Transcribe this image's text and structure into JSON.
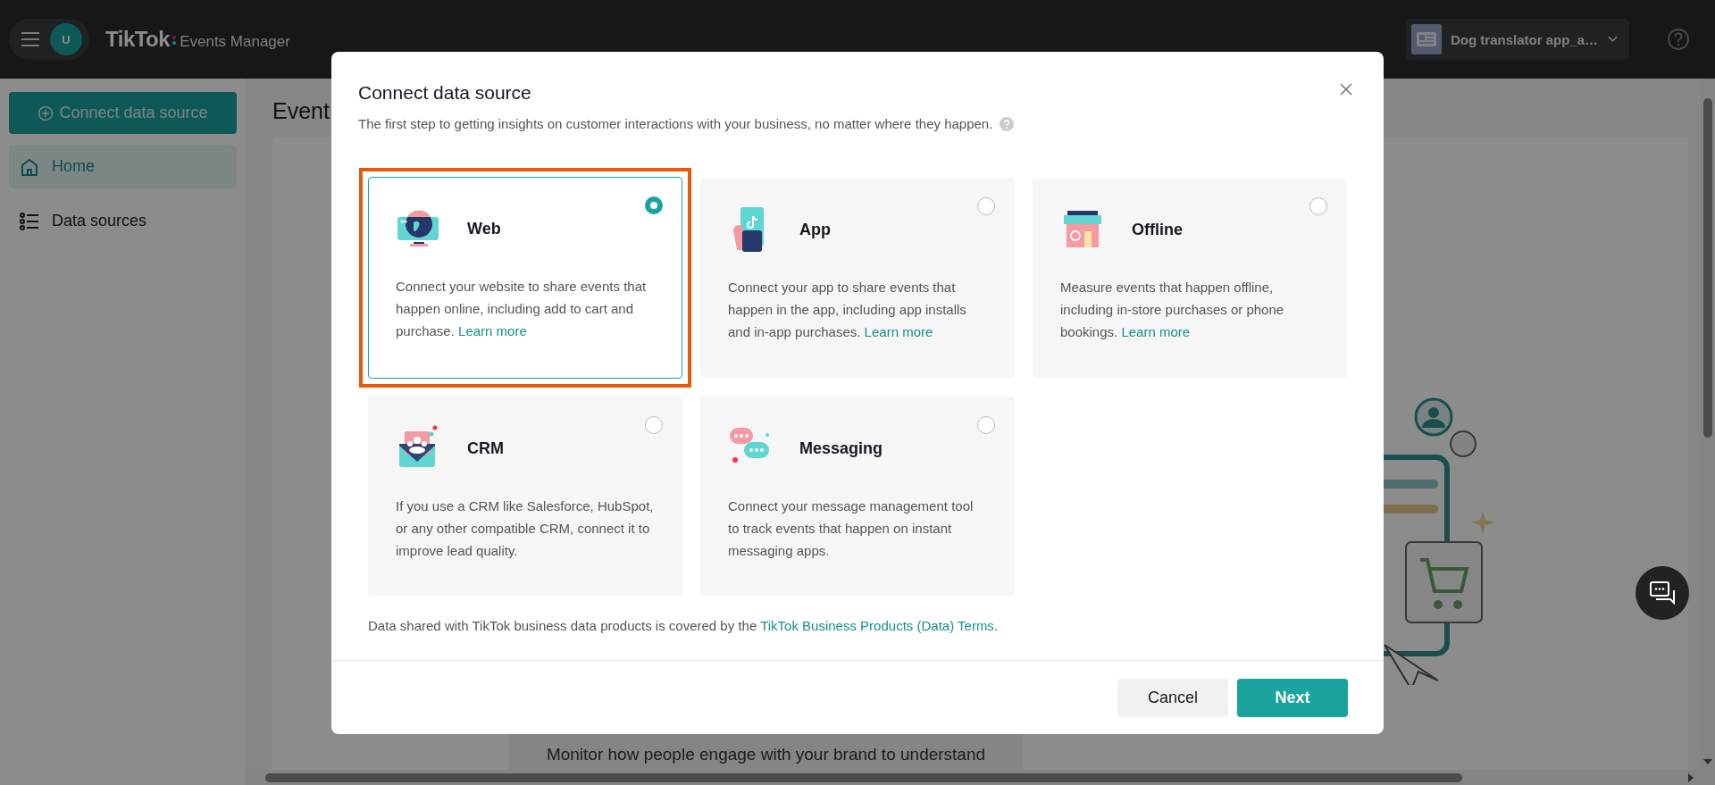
{
  "top_bar": {
    "avatar_initial": "U",
    "logo": "TikTok",
    "product": "Events Manager",
    "account": "Dog translator app_a…"
  },
  "sidebar": {
    "primary_button": "Connect data source",
    "items": [
      {
        "label": "Home",
        "kind": "home",
        "selected": true
      },
      {
        "label": "Data sources",
        "kind": "list",
        "selected": false
      }
    ]
  },
  "main": {
    "title": "Event",
    "banner_text": "Monitor how people engage with your brand to understand"
  },
  "dialog": {
    "title": "Connect data source",
    "subtitle": "The first step to getting insights on customer interactions with your business, no matter where they happen.",
    "sources": [
      {
        "kind": "web",
        "title": "Web",
        "description": "Connect your website to share events that happen online, including add to cart and purchase.",
        "link": "Learn more",
        "selected": true
      },
      {
        "kind": "app",
        "title": "App",
        "description": "Connect your app to share events that happen in the app, including app installs and in-app purchases.",
        "link": "Learn more",
        "selected": false
      },
      {
        "kind": "offline",
        "title": "Offline",
        "description": "Measure events that happen offline, including in-store purchases or phone bookings.",
        "link": "Learn more",
        "selected": false
      },
      {
        "kind": "crm",
        "title": "CRM",
        "description": "If you use a CRM like Salesforce, HubSpot, or any other compatible CRM, connect it to improve lead quality.",
        "selected": false
      },
      {
        "kind": "messaging",
        "title": "Messaging",
        "description": "Connect your message management tool to track events that happen on instant messaging apps.",
        "selected": false
      }
    ],
    "terms_prefix": "Data shared with TikTok business data products is covered by the ",
    "terms_link": "TikTok Business Products (Data) Terms",
    "terms_suffix": ".",
    "buttons": [
      {
        "label": "Cancel",
        "kind": "secondary"
      },
      {
        "label": "Next",
        "kind": "primary"
      }
    ]
  }
}
